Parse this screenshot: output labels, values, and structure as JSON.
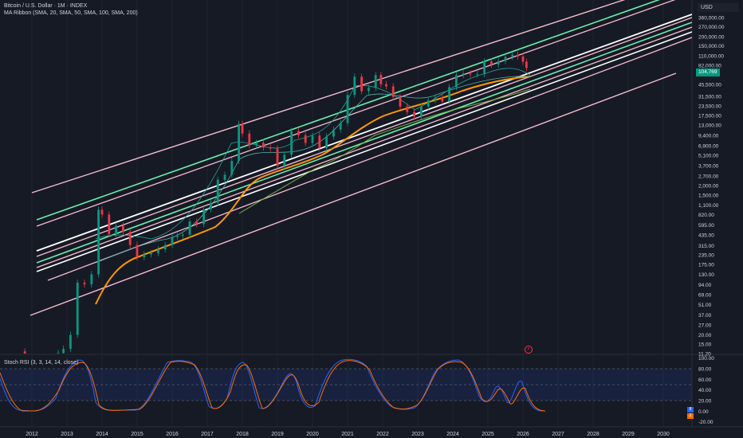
{
  "header": {
    "symbol_line": "Bitcoin / U.S. Dollar · 1M · INDEX",
    "indicator_line": "MA Ribbon (SMA, 20, SMA, 50, SMA, 100, SMA, 200)"
  },
  "currency": "USD",
  "last_price_label": "104,769",
  "price_axis": {
    "scale": "log",
    "labels": [
      "360,000.00",
      "270,000.00",
      "200,000.00",
      "150,000.00",
      "110,000.00",
      "82,000.00",
      "45,500.00",
      "31,500.00",
      "23,500.00",
      "17,500.00",
      "13,000.00",
      "9,400.00",
      "6,900.00",
      "5,100.00",
      "3,700.00",
      "2,700.00",
      "2,000.00",
      "1,500.00",
      "1,100.00",
      "820.00",
      "595.00",
      "435.00",
      "315.00",
      "235.00",
      "175.00",
      "130.00",
      "94.00",
      "69.00",
      "51.00",
      "37.00",
      "27.00",
      "20.00",
      "15.00",
      "11.20"
    ]
  },
  "time_axis": {
    "labels": [
      "2012",
      "2013",
      "2014",
      "2015",
      "2016",
      "2017",
      "2018",
      "2019",
      "2020",
      "2021",
      "2022",
      "2023",
      "2024",
      "2025",
      "2026",
      "2027",
      "2028",
      "2029",
      "2030"
    ]
  },
  "stoch_rsi": {
    "title": "Stoch RSI (3, 3, 14, 14, close)",
    "labels": [
      "100.00",
      "80.00",
      "60.00",
      "40.00",
      "20.00",
      "0.00",
      "-20.00"
    ],
    "badges": [
      {
        "text": "8",
        "color": "#2962ff"
      },
      {
        "text": "2",
        "color": "#ff6d00"
      }
    ]
  },
  "colors": {
    "background": "#161a25",
    "candle_up": "#089981",
    "candle_down": "#f23645",
    "channel_pink": "#f8bbd0",
    "channel_green": "#69f0ae",
    "channel_white": "#ffffff",
    "ma_orange": "#ff9800",
    "ma_green": "#7cb342",
    "rsi_k": "#2962ff",
    "rsi_d": "#ff6d00"
  },
  "chart_data": {
    "type": "candlestick",
    "title": "Bitcoin / U.S. Dollar · 1M · INDEX",
    "y_scale": "log",
    "ylim": [
      11.2,
      360000
    ],
    "xlim": [
      2011.25,
      2030.5
    ],
    "series": [
      {
        "points": [
          [
            2011.6,
            12
          ],
          [
            2011.8,
            10
          ],
          [
            2012.0,
            8
          ],
          [
            2012.3,
            6
          ],
          [
            2012.6,
            10
          ],
          [
            2012.9,
            13
          ],
          [
            2013.1,
            20
          ],
          [
            2013.3,
            100
          ],
          [
            2013.5,
            95
          ],
          [
            2013.7,
            130
          ],
          [
            2013.9,
            950
          ],
          [
            2014.0,
            820
          ],
          [
            2014.2,
            450
          ],
          [
            2014.4,
            580
          ],
          [
            2014.6,
            480
          ],
          [
            2014.8,
            320
          ],
          [
            2015.0,
            220
          ],
          [
            2015.2,
            240
          ],
          [
            2015.4,
            250
          ],
          [
            2015.6,
            280
          ],
          [
            2015.8,
            320
          ],
          [
            2016.0,
            410
          ],
          [
            2016.3,
            440
          ],
          [
            2016.5,
            660
          ],
          [
            2016.7,
            610
          ],
          [
            2016.9,
            960
          ],
          [
            2017.1,
            1180
          ],
          [
            2017.3,
            2400
          ],
          [
            2017.5,
            2800
          ],
          [
            2017.7,
            4300
          ],
          [
            2017.9,
            13500
          ],
          [
            2018.0,
            10000
          ],
          [
            2018.2,
            7000
          ],
          [
            2018.4,
            7500
          ],
          [
            2018.6,
            6500
          ],
          [
            2018.8,
            6300
          ],
          [
            2019.0,
            3700
          ],
          [
            2019.2,
            5200
          ],
          [
            2019.4,
            10800
          ],
          [
            2019.6,
            9500
          ],
          [
            2019.8,
            7500
          ],
          [
            2020.0,
            9400
          ],
          [
            2020.2,
            6400
          ],
          [
            2020.4,
            9100
          ],
          [
            2020.6,
            11300
          ],
          [
            2020.8,
            13800
          ],
          [
            2021.0,
            33000
          ],
          [
            2021.2,
            58000
          ],
          [
            2021.4,
            37000
          ],
          [
            2021.6,
            41000
          ],
          [
            2021.8,
            61000
          ],
          [
            2021.95,
            46000
          ],
          [
            2022.1,
            43000
          ],
          [
            2022.3,
            31000
          ],
          [
            2022.5,
            23000
          ],
          [
            2022.7,
            19500
          ],
          [
            2022.9,
            17000
          ],
          [
            2023.1,
            23000
          ],
          [
            2023.3,
            28000
          ],
          [
            2023.5,
            30500
          ],
          [
            2023.7,
            27000
          ],
          [
            2023.9,
            42000
          ],
          [
            2024.1,
            61000
          ],
          [
            2024.3,
            64000
          ],
          [
            2024.5,
            62500
          ],
          [
            2024.7,
            63000
          ],
          [
            2024.9,
            93000
          ],
          [
            2025.1,
            84000
          ],
          [
            2025.3,
            94000
          ],
          [
            2025.5,
            107000
          ],
          [
            2025.7,
            114000
          ],
          [
            2025.85,
            108000
          ],
          [
            2026.0,
            92000
          ],
          [
            2026.1,
            76000
          ]
        ]
      }
    ]
  }
}
